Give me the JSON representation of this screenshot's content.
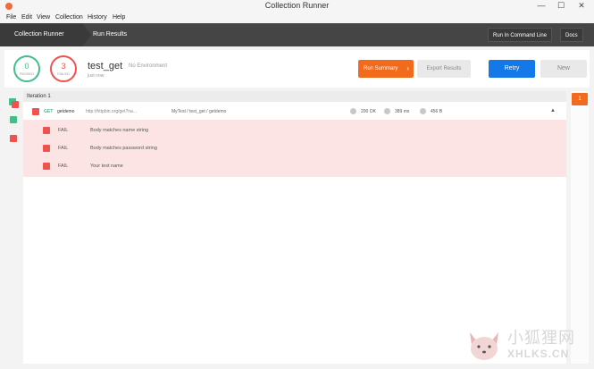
{
  "window": {
    "title": "Collection Runner",
    "controls": {
      "minimize": "—",
      "maximize": "☐",
      "close": "✕"
    }
  },
  "menu": [
    "File",
    "Edit",
    "View",
    "Collection",
    "History",
    "Help"
  ],
  "nav": {
    "crumbs": [
      "Collection Runner",
      "Run Results"
    ],
    "run_cli": "Run In Command Line",
    "docs": "Docs"
  },
  "summary": {
    "passed_count": "0",
    "passed_label": "PASSED",
    "failed_count": "3",
    "failed_label": "FAILED",
    "collection_name": "test_get",
    "run_time": "just now",
    "environment": "No Environment",
    "run_summary": "Run Summary",
    "export_results": "Export Results",
    "retry": "Retry",
    "new": "New"
  },
  "iteration": {
    "label": "Iteration 1",
    "request": {
      "method": "GET",
      "name": "getdemo",
      "url": "http://httpbin.org/get?na...",
      "path": "MyTest / test_get / getdemo",
      "status": "200 OK",
      "time": "389 ms",
      "size": "456 B"
    },
    "tests": [
      {
        "result": "FAIL",
        "name": "Body matches name string"
      },
      {
        "result": "FAIL",
        "name": "Body matches password string"
      },
      {
        "result": "FAIL",
        "name": "Your test name"
      }
    ]
  },
  "right_panel": {
    "badge": "1"
  },
  "watermark": {
    "cn": "小狐狸网",
    "en": "XHLKS.CN"
  },
  "colors": {
    "pass": "#3fbf8a",
    "fail": "#f0524d",
    "accent": "#f26b1d",
    "primary": "#1478e8",
    "nav_dark": "#454545",
    "fail_bg": "#fde4e4"
  }
}
